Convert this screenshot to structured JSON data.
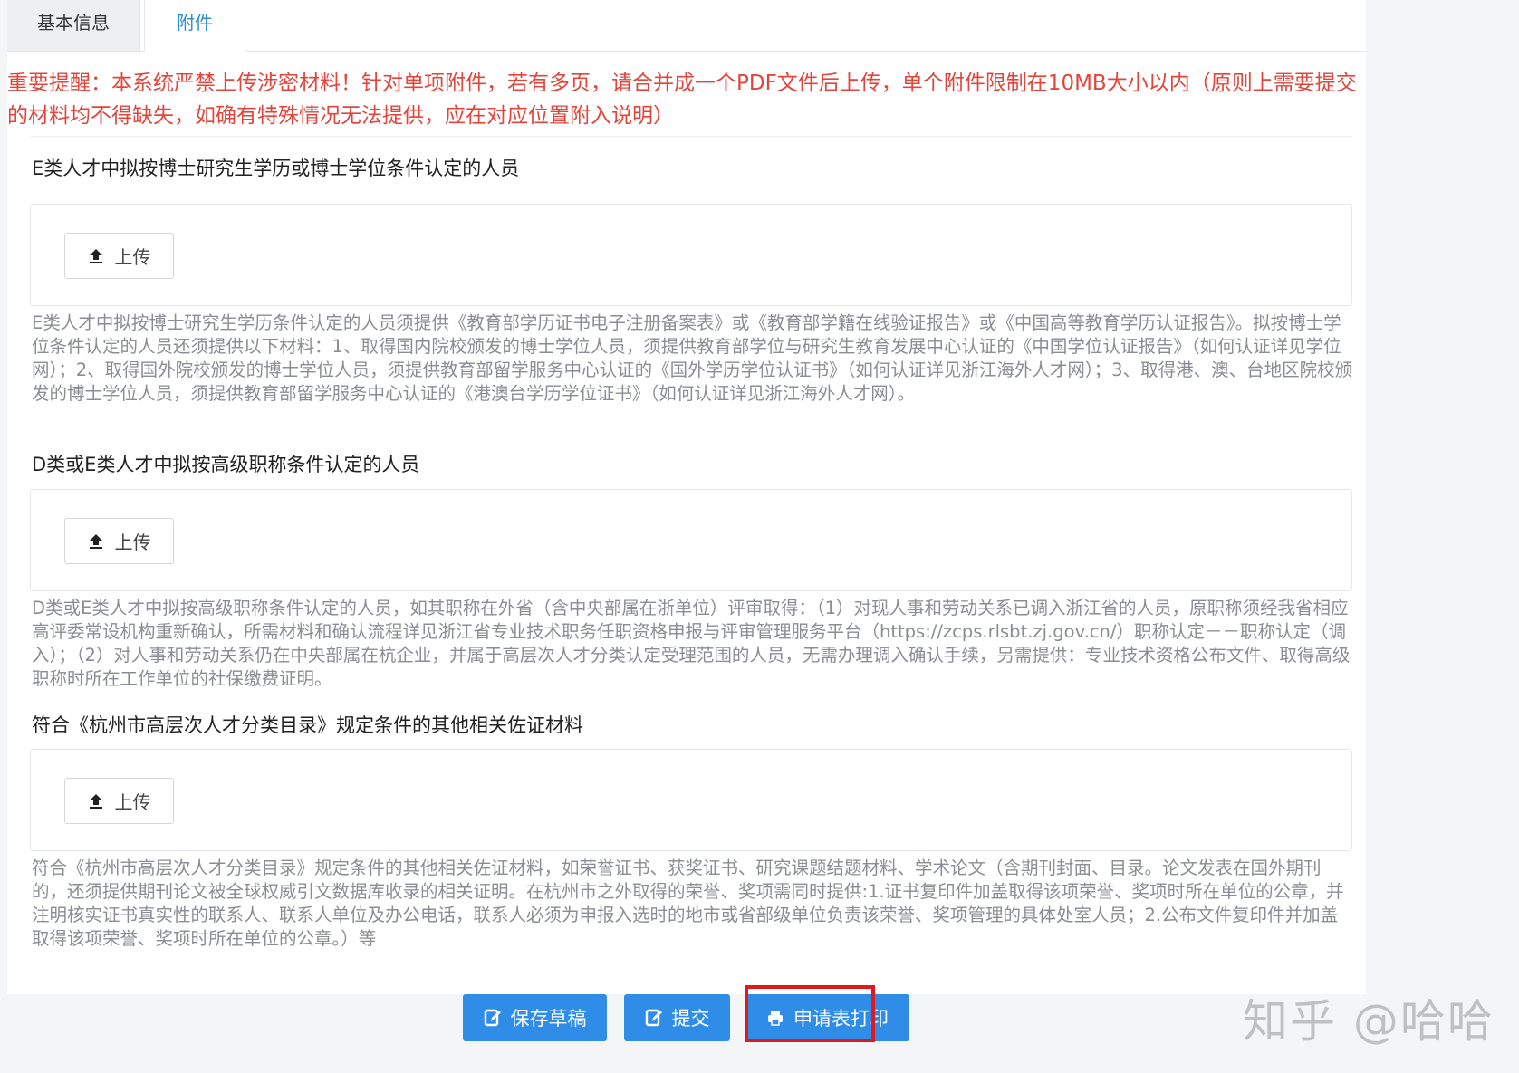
{
  "tabs": [
    {
      "label": "基本信息"
    },
    {
      "label": "附件"
    }
  ],
  "notice": "重要提醒：本系统严禁上传涉密材料！针对单项附件，若有多页，请合并成一个PDF文件后上传，单个附件限制在10MB大小以内（原则上需要提交的材料均不得缺失，如确有特殊情况无法提供，应在对应位置附入说明）",
  "sections": [
    {
      "title": "E类人才中拟按博士研究生学历或博士学位条件认定的人员",
      "upload_label": "上传",
      "description": "E类人才中拟按博士研究生学历条件认定的人员须提供《教育部学历证书电子注册备案表》或《教育部学籍在线验证报告》或《中国高等教育学历认证报告》。拟按博士学位条件认定的人员还须提供以下材料：1、取得国内院校颁发的博士学位人员，须提供教育部学位与研究生教育发展中心认证的《中国学位认证报告》（如何认证详见学位网）；2、取得国外院校颁发的博士学位人员，须提供教育部留学服务中心认证的《国外学历学位认证书》（如何认证详见浙江海外人才网）；3、取得港、澳、台地区院校颁发的博士学位人员，须提供教育部留学服务中心认证的《港澳台学历学位证书》（如何认证详见浙江海外人才网）。"
    },
    {
      "title": "D类或E类人才中拟按高级职称条件认定的人员",
      "upload_label": "上传",
      "description": "D类或E类人才中拟按高级职称条件认定的人员，如其职称在外省（含中央部属在浙单位）评审取得：（1）对现人事和劳动关系已调入浙江省的人员，原职称须经我省相应高评委常设机构重新确认，所需材料和确认流程详见浙江省专业技术职务任职资格申报与评审管理服务平台（https://zcps.rlsbt.zj.gov.cn/）职称认定－－职称认定（调入）；（2）对人事和劳动关系仍在中央部属在杭企业，并属于高层次人才分类认定受理范围的人员，无需办理调入确认手续，另需提供：专业技术资格公布文件、取得高级职称时所在工作单位的社保缴费证明。"
    },
    {
      "title": "符合《杭州市高层次人才分类目录》规定条件的其他相关佐证材料",
      "upload_label": "上传",
      "description": "符合《杭州市高层次人才分类目录》规定条件的其他相关佐证材料，如荣誉证书、获奖证书、研究课题结题材料、学术论文（含期刊封面、目录。论文发表在国外期刊的，还须提供期刊论文被全球权威引文数据库收录的相关证明。在杭州市之外取得的荣誉、奖项需同时提供:1.证书复印件加盖取得该项荣誉、奖项时所在单位的公章，并注明核实证书真实性的联系人、联系人单位及办公电话，联系人必须为申报入选时的地市或省部级单位负责该荣誉、奖项管理的具体处室人员；2.公布文件复印件并加盖取得该项荣誉、奖项时所在单位的公章。）等"
    }
  ],
  "footer": {
    "save_label": "保存草稿",
    "submit_label": "提交",
    "print_label": "申请表打印"
  },
  "watermark": "知乎 @哈哈",
  "colors": {
    "notice": "#e2453b",
    "primary": "#2f8de8",
    "highlight": "#e0191e",
    "active_tab": "#2f8bd6"
  },
  "icons": {
    "upload": "upload-icon",
    "save": "edit-icon",
    "submit": "edit-icon",
    "print": "printer-icon"
  }
}
